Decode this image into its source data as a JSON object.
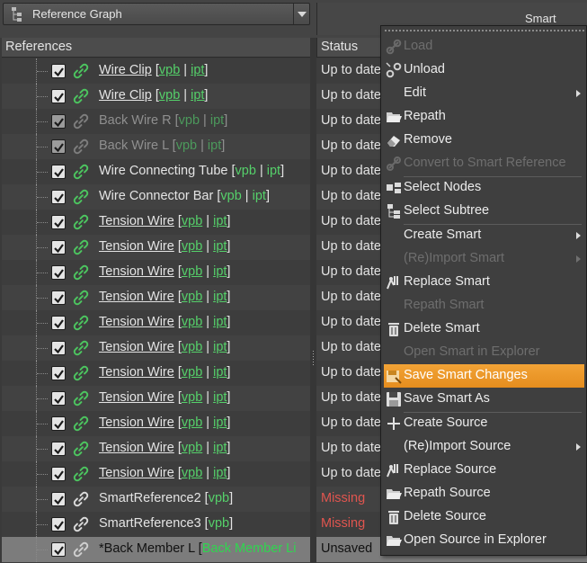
{
  "toolbar": {
    "graph_selector": "Reference Graph",
    "smart_header": "Smart"
  },
  "columns": {
    "references": "References",
    "status": "Status"
  },
  "references": [
    {
      "name": "Wire Clip",
      "links": [
        "vpb",
        "ipt"
      ],
      "underline": true,
      "state": "normal",
      "status": "Up to date"
    },
    {
      "name": "Wire Clip",
      "links": [
        "vpb",
        "ipt"
      ],
      "underline": true,
      "state": "normal",
      "status": "Up to date"
    },
    {
      "name": "Back Wire R",
      "links": [
        "vpb",
        "ipt"
      ],
      "underline": false,
      "state": "disabled",
      "status": "Up to date"
    },
    {
      "name": "Back Wire L",
      "links": [
        "vpb",
        "ipt"
      ],
      "underline": false,
      "state": "disabled",
      "status": "Up to date"
    },
    {
      "name": "Wire Connecting Tube",
      "links": [
        "vpb",
        "ipt"
      ],
      "underline": false,
      "state": "normal",
      "status": "Up to date"
    },
    {
      "name": "Wire Connector Bar",
      "links": [
        "vpb",
        "ipt"
      ],
      "underline": false,
      "state": "normal",
      "status": "Up to date"
    },
    {
      "name": "Tension Wire",
      "links": [
        "vpb",
        "ipt"
      ],
      "underline": true,
      "state": "normal",
      "status": "Up to date"
    },
    {
      "name": "Tension Wire",
      "links": [
        "vpb",
        "ipt"
      ],
      "underline": true,
      "state": "normal",
      "status": "Up to date"
    },
    {
      "name": "Tension Wire",
      "links": [
        "vpb",
        "ipt"
      ],
      "underline": true,
      "state": "normal",
      "status": "Up to date"
    },
    {
      "name": "Tension Wire",
      "links": [
        "vpb",
        "ipt"
      ],
      "underline": true,
      "state": "normal",
      "status": "Up to date"
    },
    {
      "name": "Tension Wire",
      "links": [
        "vpb",
        "ipt"
      ],
      "underline": true,
      "state": "normal",
      "status": "Up to date"
    },
    {
      "name": "Tension Wire",
      "links": [
        "vpb",
        "ipt"
      ],
      "underline": true,
      "state": "normal",
      "status": "Up to date"
    },
    {
      "name": "Tension Wire",
      "links": [
        "vpb",
        "ipt"
      ],
      "underline": true,
      "state": "normal",
      "status": "Up to date"
    },
    {
      "name": "Tension Wire",
      "links": [
        "vpb",
        "ipt"
      ],
      "underline": true,
      "state": "normal",
      "status": "Up to date"
    },
    {
      "name": "Tension Wire",
      "links": [
        "vpb",
        "ipt"
      ],
      "underline": true,
      "state": "normal",
      "status": "Up to date"
    },
    {
      "name": "Tension Wire",
      "links": [
        "vpb",
        "ipt"
      ],
      "underline": true,
      "state": "normal",
      "status": "Up to date"
    },
    {
      "name": "Tension Wire",
      "links": [
        "vpb",
        "ipt"
      ],
      "underline": true,
      "state": "normal",
      "status": "Up to date"
    },
    {
      "name": "SmartReference2",
      "links": [
        "vpb"
      ],
      "underline": false,
      "state": "smart",
      "status": "Missing"
    },
    {
      "name": "SmartReference3",
      "links": [
        "vpb"
      ],
      "underline": false,
      "state": "smart",
      "status": "Missing"
    },
    {
      "name": "*Back Member L",
      "links": [
        "Back Member Li"
      ],
      "underline": false,
      "state": "unsaved",
      "status": "Unsaved"
    }
  ],
  "context_menu": {
    "items": [
      {
        "label": "Load",
        "icon": "link-icon",
        "disabled": true
      },
      {
        "label": "Unload",
        "icon": "broken-link-icon",
        "disabled": false
      },
      {
        "label": "Edit",
        "icon": "",
        "disabled": false,
        "submenu": true
      },
      {
        "label": "Repath",
        "icon": "folder-open-icon",
        "disabled": false
      },
      {
        "label": "Remove",
        "icon": "eraser-icon",
        "disabled": false
      },
      {
        "label": "Convert to Smart Reference",
        "icon": "convert-icon",
        "disabled": true,
        "separator_after": true
      },
      {
        "label": "Select Nodes",
        "icon": "select-nodes-icon",
        "disabled": false
      },
      {
        "label": "Select Subtree",
        "icon": "select-subtree-icon",
        "disabled": false,
        "separator_after": true
      },
      {
        "label": "Create Smart",
        "icon": "",
        "disabled": false,
        "submenu": true
      },
      {
        "label": "(Re)Import Smart",
        "icon": "",
        "disabled": true,
        "submenu": true
      },
      {
        "label": "Replace Smart",
        "icon": "replace-icon",
        "disabled": false
      },
      {
        "label": "Repath Smart",
        "icon": "",
        "disabled": true
      },
      {
        "label": "Delete Smart",
        "icon": "trash-icon",
        "disabled": false
      },
      {
        "label": "Open Smart in Explorer",
        "icon": "",
        "disabled": true
      },
      {
        "label": "Save Smart Changes",
        "icon": "save-changes-icon",
        "disabled": false,
        "highlighted": true
      },
      {
        "label": "Save Smart As",
        "icon": "floppy-icon",
        "disabled": false,
        "separator_after": true
      },
      {
        "label": "Create Source",
        "icon": "plus-icon",
        "disabled": false
      },
      {
        "label": "(Re)Import Source",
        "icon": "",
        "disabled": false,
        "submenu": true
      },
      {
        "label": "Replace Source",
        "icon": "replace-icon",
        "disabled": false
      },
      {
        "label": "Repath Source",
        "icon": "folder-open-icon",
        "disabled": false
      },
      {
        "label": "Delete Source",
        "icon": "trash-icon",
        "disabled": false
      },
      {
        "label": "Open Source in Explorer",
        "icon": "folder-open-icon",
        "disabled": false
      }
    ]
  },
  "colors": {
    "link_green": "#55d06a",
    "missing_red": "#e0554f",
    "highlight_orange": "#f2a336",
    "unsaved_row": "#7c7c7c"
  }
}
